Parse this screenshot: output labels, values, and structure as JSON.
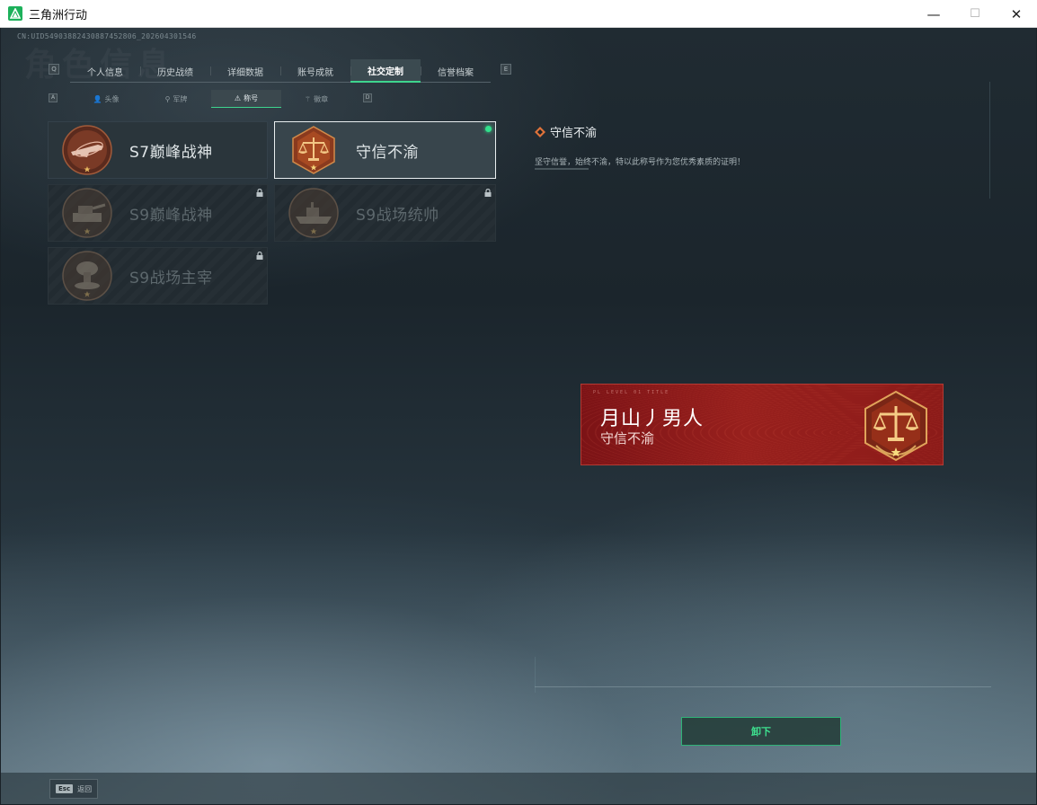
{
  "window": {
    "title": "三角洲行动",
    "minimize": "—",
    "maximize": "☐",
    "close": "✕"
  },
  "uid": "CN:UID5490388243088745280​6_202604301546",
  "watermark": "角色信息",
  "key_hints": {
    "tab_left": "Q",
    "tab_right": "E",
    "sub_left": "A",
    "sub_right": "D"
  },
  "tabs": [
    {
      "label": "个人信息",
      "active": false
    },
    {
      "label": "历史战绩",
      "active": false
    },
    {
      "label": "详细数据",
      "active": false
    },
    {
      "label": "账号成就",
      "active": false
    },
    {
      "label": "社交定制",
      "active": true
    },
    {
      "label": "信誉档案",
      "active": false
    }
  ],
  "subtabs": [
    {
      "label": "头像",
      "icon": "person-icon",
      "glyph": "👤",
      "active": false
    },
    {
      "label": "军牌",
      "icon": "dogtag-icon",
      "glyph": "⚲",
      "active": false
    },
    {
      "label": "称号",
      "icon": "title-icon",
      "glyph": "⚠",
      "active": true
    },
    {
      "label": "徽章",
      "icon": "badge-icon",
      "glyph": "⚚",
      "active": false
    }
  ],
  "titles": [
    {
      "label": "S7巅峰战神",
      "locked": false,
      "selected": false,
      "emblem": "rifle-emblem"
    },
    {
      "label": "守信不渝",
      "locked": false,
      "selected": true,
      "equipped": true,
      "emblem": "scales-emblem"
    },
    {
      "label": "S9巅峰战神",
      "locked": true,
      "selected": false,
      "emblem": "tank-emblem"
    },
    {
      "label": "S9战场统帅",
      "locked": true,
      "selected": false,
      "emblem": "ship-emblem"
    },
    {
      "label": "S9战场主宰",
      "locked": true,
      "selected": false,
      "emblem": "explosion-emblem"
    }
  ],
  "detail": {
    "name": "守信不渝",
    "description": "坚守信誉，始终不渝，特以此称号作为您优秀素质的证明！"
  },
  "banner": {
    "small_text": "PL LEVEL  01  TITLE",
    "player_name": "月山丿男人",
    "title": "守信不渝"
  },
  "actions": {
    "unequip": "卸下",
    "esc": "Esc",
    "back": "返回"
  },
  "colors": {
    "accent": "#3ee08f",
    "banner_red": "#8c1b19",
    "emblem_bronze": "#b56a33"
  }
}
